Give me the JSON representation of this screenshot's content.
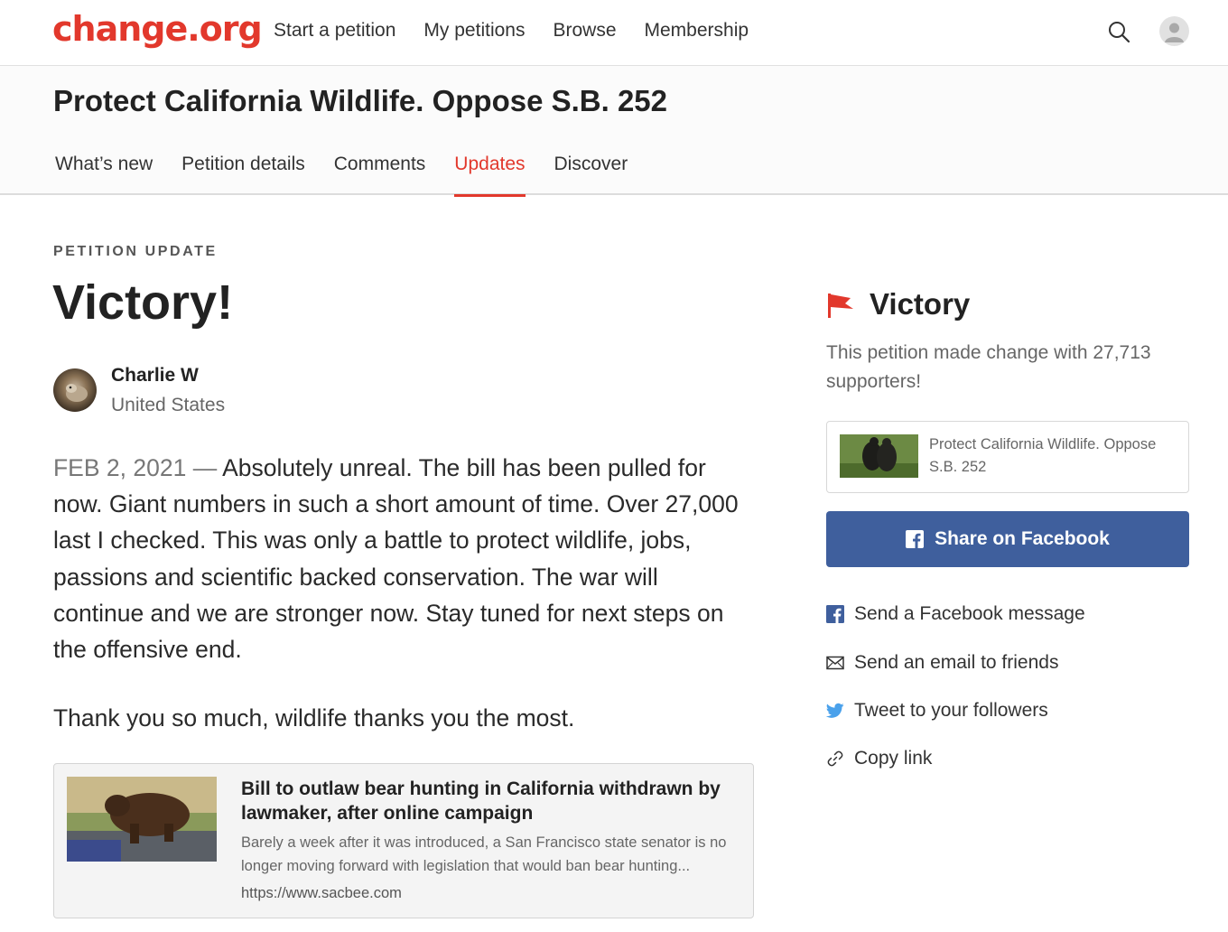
{
  "colors": {
    "brand": "#e2382c",
    "facebook": "#3f5f9d",
    "twitter": "#4aa1eb"
  },
  "topnav": {
    "logo": "change.org",
    "links": [
      "Start a petition",
      "My petitions",
      "Browse",
      "Membership"
    ],
    "icons": [
      "search-icon",
      "user-avatar-icon"
    ]
  },
  "petition": {
    "title": "Protect California Wildlife. Oppose S.B. 252",
    "tabs": [
      "What’s new",
      "Petition details",
      "Comments",
      "Updates",
      "Discover"
    ],
    "active_tab": "Updates"
  },
  "update": {
    "eyebrow": "PETITION UPDATE",
    "headline": "Victory!",
    "author": {
      "name": "Charlie W",
      "location": "United States"
    },
    "date": "FEB 2, 2021",
    "separator": " — ",
    "body": "Absolutely unreal. The bill has been pulled for now. Giant numbers in such a short amount of time. Over 27,000 last I checked. This was only a battle to protect wildlife, jobs, passions and scientific backed conservation. The war will continue and we are stronger now. Stay tuned for next steps on the offensive end.",
    "thanks": "Thank you so much, wildlife thanks you the most.",
    "link_card": {
      "title": "Bill to outlaw bear hunting in California withdrawn by lawmaker, after online campaign",
      "description": "Barely a week after it was introduced, a San Francisco state senator is no longer moving forward with legislation that would ban bear hunting...",
      "url": "https://www.sacbee.com"
    }
  },
  "sidebar": {
    "victory_title": "Victory",
    "victory_sub": "This petition made change with 27,713 supporters!",
    "petition_card_title": "Protect California Wildlife. Oppose S.B. 252",
    "facebook_button": "Share on Facebook",
    "share_options": [
      {
        "icon": "facebook-icon",
        "label": "Send a Facebook message"
      },
      {
        "icon": "email-icon",
        "label": "Send an email to friends"
      },
      {
        "icon": "twitter-icon",
        "label": "Tweet to your followers"
      },
      {
        "icon": "link-icon",
        "label": "Copy link"
      }
    ]
  }
}
